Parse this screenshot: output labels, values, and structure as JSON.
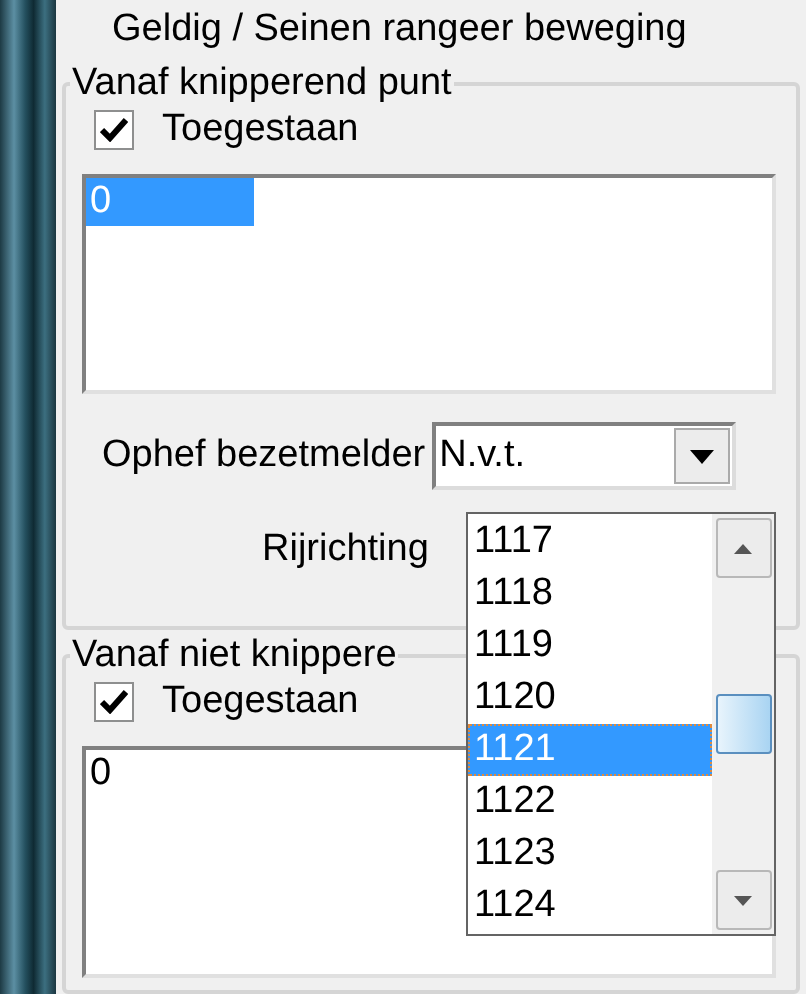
{
  "header": {
    "title": "Geldig / Seinen rangeer beweging"
  },
  "groups": [
    {
      "title": "Vanaf knipperend punt",
      "checkbox": {
        "label": "Toegestaan",
        "checked": true
      },
      "list": [
        {
          "text": "0",
          "selected": true
        }
      ],
      "fields": [
        {
          "kind": "combo",
          "label": "Ophef bezetmelder",
          "value": "N.v.t."
        },
        {
          "kind": "label",
          "label": "Rijrichting"
        }
      ]
    },
    {
      "title": "Vanaf niet knippere",
      "checkbox": {
        "label": "Toegestaan",
        "checked": true
      },
      "list": [
        {
          "text": "0",
          "selected": false
        }
      ]
    }
  ],
  "dropdown": {
    "items": [
      {
        "text": "1117",
        "selected": false
      },
      {
        "text": "1118",
        "selected": false
      },
      {
        "text": "1119",
        "selected": false
      },
      {
        "text": "1120",
        "selected": false
      },
      {
        "text": "1121",
        "selected": true
      },
      {
        "text": "1122",
        "selected": false
      },
      {
        "text": "1123",
        "selected": false
      },
      {
        "text": "1124",
        "selected": false
      }
    ]
  }
}
